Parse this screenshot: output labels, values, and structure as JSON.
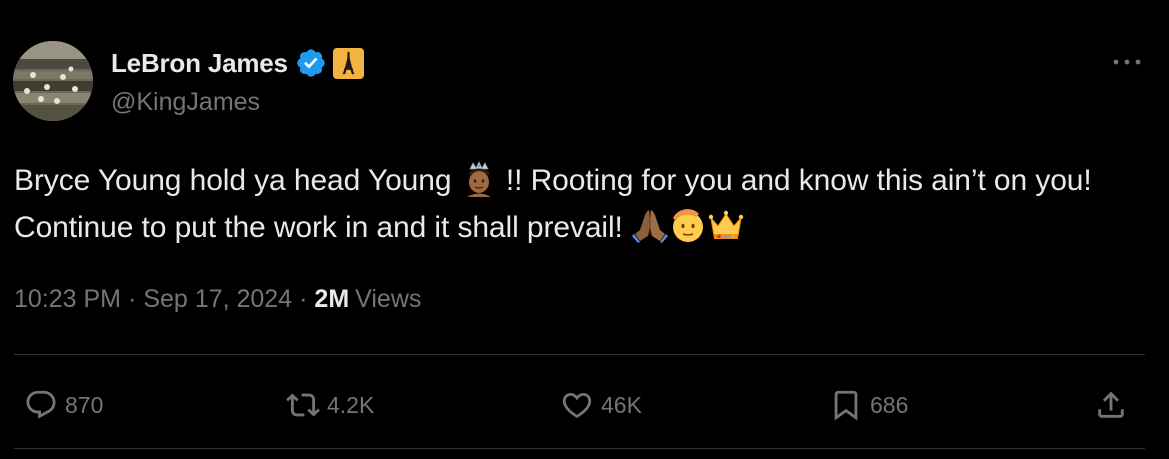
{
  "author": {
    "display_name": "LeBron James",
    "handle": "@KingJames",
    "verified_icon": "verified-badge-icon",
    "affiliation_icon": "eiffel-tower-badge-icon",
    "verified_color": "#1d9bf0"
  },
  "tweet": {
    "text_part1": "Bryce Young hold ya head Young ",
    "text_part2": " !! Rooting for you and know this ain’t on you! Continue to put the work in and it shall prevail! ",
    "emojis": [
      "crowned-person-emoji",
      "folded-hands-emoji",
      "saluting-face-emoji",
      "crown-emoji"
    ]
  },
  "meta": {
    "time": "10:23 PM",
    "separator": "·",
    "date": "Sep 17, 2024",
    "views_count": "2M",
    "views_label": "Views"
  },
  "actions": {
    "replies": "870",
    "reposts": "4.2K",
    "likes": "46K",
    "bookmarks": "686"
  },
  "colors": {
    "background": "#000000",
    "primary_text": "#e7e9ea",
    "secondary_text": "#71767b",
    "divider": "#2f3336"
  }
}
